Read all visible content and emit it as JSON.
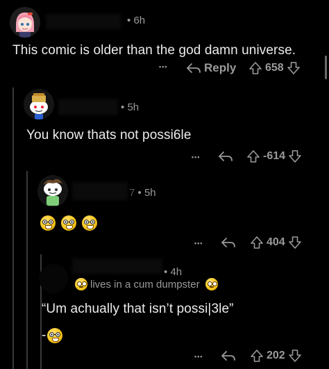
{
  "comments": [
    {
      "time": "6h",
      "text": "This comic is older than the god damn universe.",
      "more": "•••",
      "reply_label": "Reply",
      "score": "658"
    },
    {
      "time": "5h",
      "text": "You know thats not possi6le",
      "more": "•••",
      "score": "-614"
    },
    {
      "time": "5h",
      "username_fragment": "7",
      "more": "•••",
      "score": "404"
    },
    {
      "time": "4h",
      "flair": "lives in a cum dumpster",
      "text": "“Um achually that isn’t possi|3le”",
      "prefix": "-",
      "more": "•••",
      "score": "202"
    }
  ],
  "colors": {
    "background": "#000000",
    "text": "#ececec",
    "muted": "#9a9a9a",
    "thread_line": "#3a3a3a"
  },
  "icons": [
    "reply-arrow-icon",
    "upvote-icon",
    "downvote-icon",
    "more-icon",
    "nerd-emoji-icon",
    "flushed-emoji-icon"
  ]
}
